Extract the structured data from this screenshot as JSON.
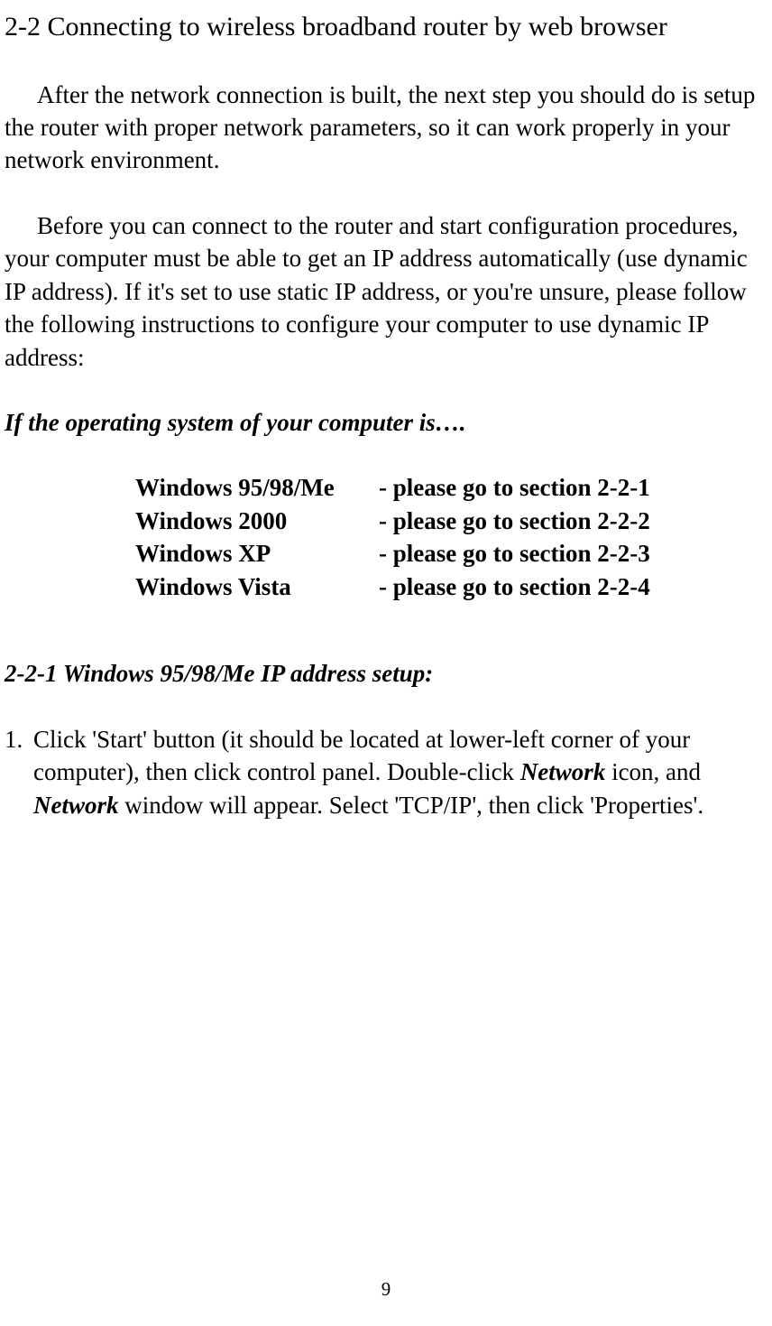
{
  "section_title": "2-2 Connecting to wireless broadband router by web browser",
  "para1": "After the network connection is built, the next step you should do is setup the router with proper network parameters, so it can work properly in your network environment.",
  "para2": "Before you can connect to the router and start configuration procedures, your computer must be able to get an IP address automatically (use dynamic IP address). If it's set to use static IP address, or you're unsure, please follow the following instructions to configure your computer to use dynamic IP address:",
  "os_prompt": "If the operating system of your computer is….",
  "os_table": [
    {
      "name": "Windows 95/98/Me",
      "section": "- please go to section 2-2-1"
    },
    {
      "name": "Windows 2000",
      "section": "- please go to section 2-2-2"
    },
    {
      "name": "Windows XP",
      "section": "- please go to section 2-2-3"
    },
    {
      "name": "Windows Vista",
      "section": "- please go to section 2-2-4"
    }
  ],
  "subsection_title": "2-2-1 Windows 95/98/Me IP address setup:",
  "step1": {
    "number": "1.",
    "pre": "Click 'Start' button (it should be located at lower-left corner of your computer), then click control panel. Double-click ",
    "em1": "Network",
    "mid": " icon, and ",
    "em2": "Network",
    "post": " window will appear. Select 'TCP/IP', then click 'Properties'."
  },
  "page_number": "9"
}
